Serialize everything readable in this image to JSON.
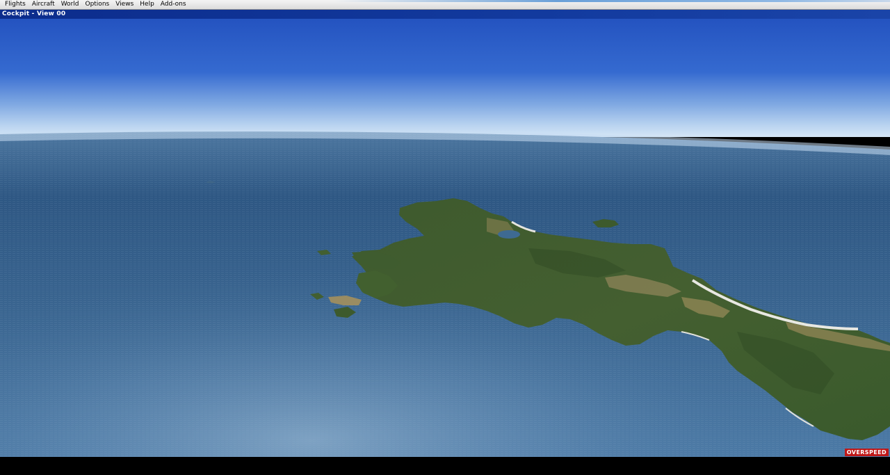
{
  "menu": {
    "items": [
      "Flights",
      "Aircraft",
      "World",
      "Options",
      "Views",
      "Help",
      "Add-ons"
    ]
  },
  "view": {
    "title": "Cockpit - View 00"
  },
  "warning": {
    "label": "OVERSPEED",
    "color": "#c01818"
  },
  "colors": {
    "sky_top": "#2a5bc4",
    "sky_horizon": "#c6dcf2",
    "sea": "#2f5a86",
    "land": "#3d5a2c",
    "beach": "#c9b890"
  }
}
